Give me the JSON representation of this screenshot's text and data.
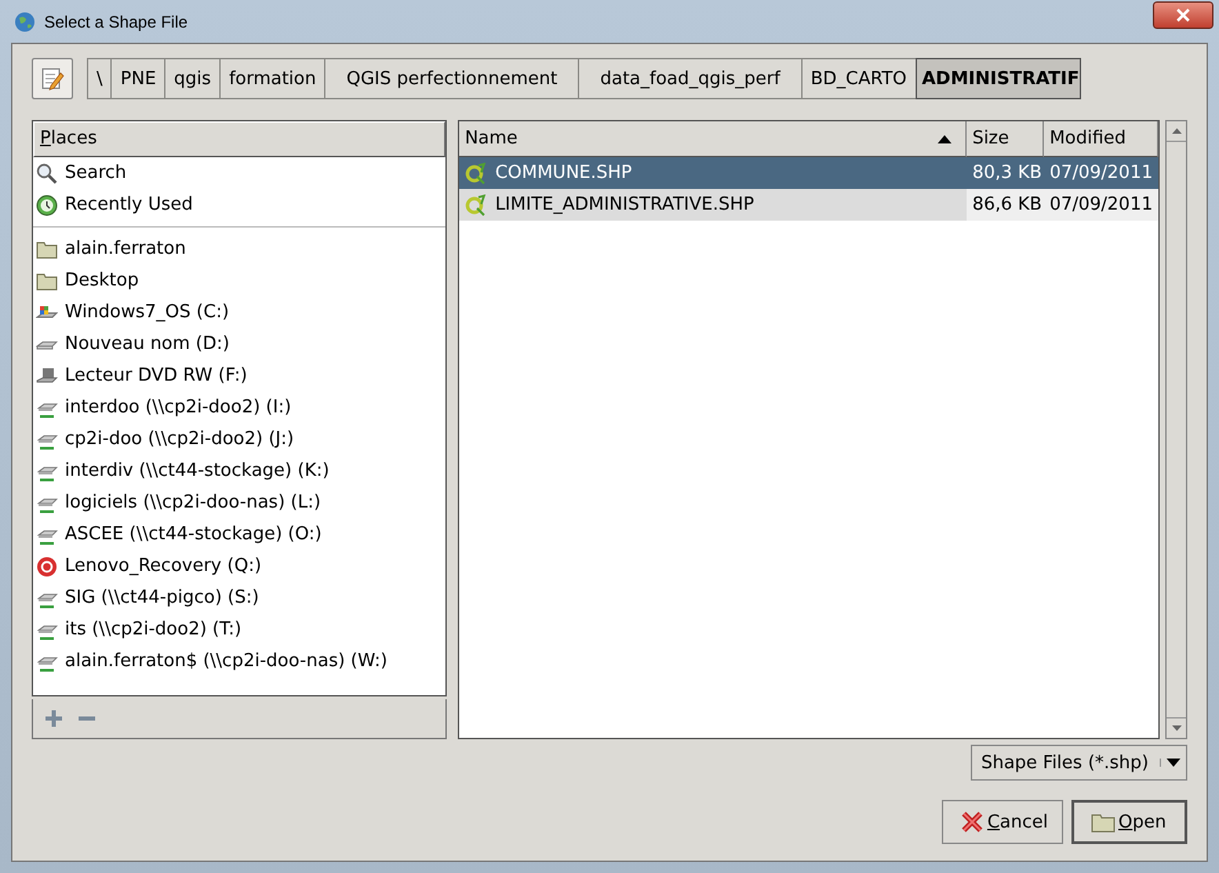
{
  "window": {
    "title": "Select a Shape File"
  },
  "path_bar": [
    {
      "label": "\\",
      "selected": false
    },
    {
      "label": "PNE",
      "selected": false
    },
    {
      "label": "qgis",
      "selected": false
    },
    {
      "label": "formation",
      "selected": false
    },
    {
      "label": "QGIS perfectionnement",
      "selected": false
    },
    {
      "label": "data_foad_qgis_perf",
      "selected": false
    },
    {
      "label": "BD_CARTO",
      "selected": false
    },
    {
      "label": "ADMINISTRATIF",
      "selected": true
    }
  ],
  "places": {
    "header": "Places",
    "groups": [
      [
        {
          "label": "Search",
          "kind": "search"
        },
        {
          "label": "Recently Used",
          "kind": "recent"
        }
      ],
      [
        {
          "label": "alain.ferraton",
          "kind": "folder"
        },
        {
          "label": "Desktop",
          "kind": "folder"
        },
        {
          "label": "Windows7_OS (C:)",
          "kind": "system"
        },
        {
          "label": "Nouveau nom (D:)",
          "kind": "drive"
        },
        {
          "label": "Lecteur DVD RW (F:)",
          "kind": "dvd"
        },
        {
          "label": "interdoo (\\\\cp2i-doo2) (I:)",
          "kind": "network"
        },
        {
          "label": "cp2i-doo (\\\\cp2i-doo2) (J:)",
          "kind": "network"
        },
        {
          "label": "interdiv (\\\\ct44-stockage) (K:)",
          "kind": "network"
        },
        {
          "label": "logiciels (\\\\cp2i-doo-nas) (L:)",
          "kind": "network"
        },
        {
          "label": "ASCEE (\\\\ct44-stockage) (O:)",
          "kind": "network"
        },
        {
          "label": "Lenovo_Recovery (Q:)",
          "kind": "recovery"
        },
        {
          "label": "SIG (\\\\ct44-pigco) (S:)",
          "kind": "network"
        },
        {
          "label": "its (\\\\cp2i-doo2) (T:)",
          "kind": "network"
        },
        {
          "label": "alain.ferraton$ (\\\\cp2i-doo-nas) (W:)",
          "kind": "network"
        }
      ]
    ]
  },
  "files": {
    "columns": [
      {
        "label": "Name",
        "sorted": true
      },
      {
        "label": "Size",
        "sorted": false
      },
      {
        "label": "Modified",
        "sorted": false
      }
    ],
    "rows": [
      {
        "name": "COMMUNE.SHP",
        "size": "80,3 KB",
        "modified": "07/09/2011",
        "selected": true
      },
      {
        "name": "LIMITE_ADMINISTRATIVE.SHP",
        "size": "86,6 KB",
        "modified": "07/09/2011",
        "selected": false
      }
    ]
  },
  "filter": {
    "value": "Shape Files (*.shp)"
  },
  "buttons": [
    {
      "label": "Cancel",
      "kind": "cancel"
    },
    {
      "label": "Open",
      "kind": "open"
    }
  ]
}
